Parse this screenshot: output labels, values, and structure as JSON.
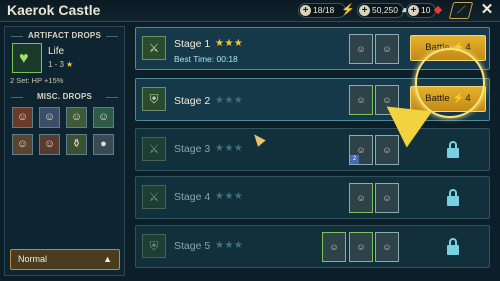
{
  "topbar": {
    "title": "Kaerok Castle",
    "energy": "18/18",
    "silver": "50,250",
    "gems": "10"
  },
  "left": {
    "artifact_drops_title": "ARTIFACT DROPS",
    "artifact_name": "Life",
    "artifact_range": "1 - 3",
    "set_bonus": "2 Set: HP +15%",
    "misc_drops_title": "MISC. DROPS",
    "difficulty": "Normal"
  },
  "stages": [
    {
      "name": "Stage 1",
      "stars": "★★★",
      "best": "Best Time: 00:18",
      "battle": "Battle",
      "energy": "4"
    },
    {
      "name": "Stage 2",
      "stars": "★★★",
      "battle": "Battle",
      "energy": "4"
    },
    {
      "name": "Stage 3",
      "stars": "★★★"
    },
    {
      "name": "Stage 4",
      "stars": "★★★"
    },
    {
      "name": "Stage 5",
      "stars": "★★★"
    }
  ],
  "colors": {
    "accent_gold": "#e6b12e",
    "star_gold": "#f2c53a",
    "lock_blue": "#78d1e3"
  },
  "icons": {
    "energy": "lightning-icon",
    "silver": "silver-bar-icon",
    "gems": "ruby-icon",
    "close": "close-icon",
    "lock": "lock-icon"
  }
}
